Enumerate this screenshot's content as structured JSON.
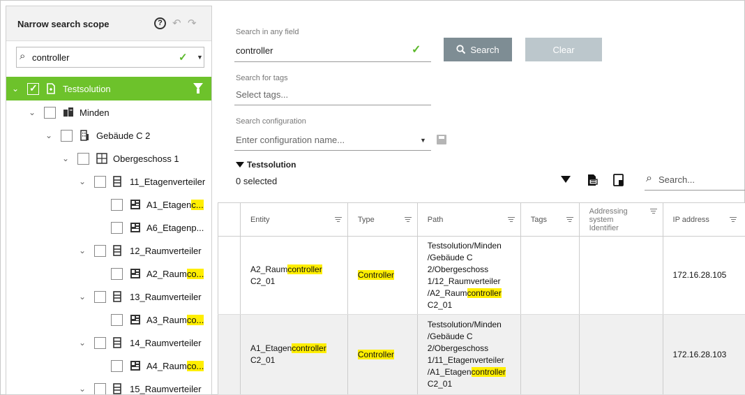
{
  "scope": {
    "title": "Narrow search scope",
    "search_value": "controller",
    "tree": [
      {
        "label_a": "Testsolution",
        "label_hl": "",
        "label_b": ""
      },
      {
        "label_a": "Minden",
        "label_hl": "",
        "label_b": ""
      },
      {
        "label_a": "Gebäude C 2",
        "label_hl": "",
        "label_b": ""
      },
      {
        "label_a": "Obergeschoss 1",
        "label_hl": "",
        "label_b": ""
      },
      {
        "label_a": "11_Etagenverteiler",
        "label_hl": "",
        "label_b": ""
      },
      {
        "label_a": "A1_Etagen",
        "label_hl": "c...",
        "label_b": ""
      },
      {
        "label_a": "A6_Etagenp...",
        "label_hl": "",
        "label_b": ""
      },
      {
        "label_a": "12_Raumverteiler",
        "label_hl": "",
        "label_b": ""
      },
      {
        "label_a": "A2_Raum",
        "label_hl": "co...",
        "label_b": ""
      },
      {
        "label_a": "13_Raumverteiler",
        "label_hl": "",
        "label_b": ""
      },
      {
        "label_a": "A3_Raum",
        "label_hl": "co...",
        "label_b": ""
      },
      {
        "label_a": "14_Raumverteiler",
        "label_hl": "",
        "label_b": ""
      },
      {
        "label_a": "A4_Raum",
        "label_hl": "co...",
        "label_b": ""
      },
      {
        "label_a": "15_Raumverteiler",
        "label_hl": "",
        "label_b": ""
      }
    ]
  },
  "search": {
    "any_field_label": "Search in any field",
    "any_field_value": "controller",
    "search_button": "Search",
    "clear_button": "Clear",
    "tags_label": "Search for tags",
    "tags_placeholder": "Select tags...",
    "config_label": "Search configuration",
    "config_placeholder": "Enter configuration name..."
  },
  "results": {
    "filter_name": "Testsolution",
    "selected_text": "0 selected",
    "table_search_placeholder": "Search...",
    "columns": [
      "Entity",
      "Type",
      "Path",
      "Tags",
      "Addressing system Identifier",
      "IP address"
    ],
    "rows": [
      {
        "entity_a": "A2_Raum",
        "entity_hl": "controller",
        "entity_b": "C2_01",
        "type": "Controller",
        "path_1": "Testsolution/Minden",
        "path_2": "/Gebäude C",
        "path_3": "2/Obergeschoss",
        "path_4": "1/12_Raumverteiler",
        "path_5a": "/A2_Raum",
        "path_5hl": "controller",
        "path_6": "C2_01",
        "tags": "",
        "asi": "",
        "ip": "172.16.28.105"
      },
      {
        "entity_a": "A1_Etagen",
        "entity_hl": "controller",
        "entity_b": "C2_01",
        "type": "Controller",
        "path_1": "Testsolution/Minden",
        "path_2": "/Gebäude C",
        "path_3": "2/Obergeschoss",
        "path_4": "1/11_Etagenverteiler",
        "path_5a": "/A1_Etagen",
        "path_5hl": "controller",
        "path_6": "C2_01",
        "tags": "",
        "asi": "",
        "ip": "172.16.28.103"
      }
    ]
  }
}
